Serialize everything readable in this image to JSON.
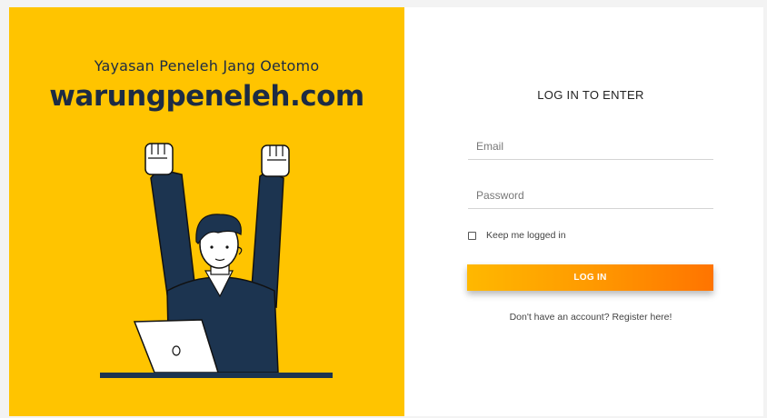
{
  "hero": {
    "subtitle": "Yayasan Peneleh Jang Oetomo",
    "title": "warungpeneleh.com",
    "background_color": "#ffc400",
    "text_color": "#1c2b44"
  },
  "login": {
    "heading": "LOG IN TO ENTER",
    "email_placeholder": "Email",
    "password_placeholder": "Password",
    "keep_logged_in_label": "Keep me logged in",
    "keep_logged_in_checked": false,
    "button_label": "LOG IN",
    "button_gradient": [
      "#ffb800",
      "#ff7400"
    ],
    "register_link": "Don't have an account? Register here!"
  }
}
